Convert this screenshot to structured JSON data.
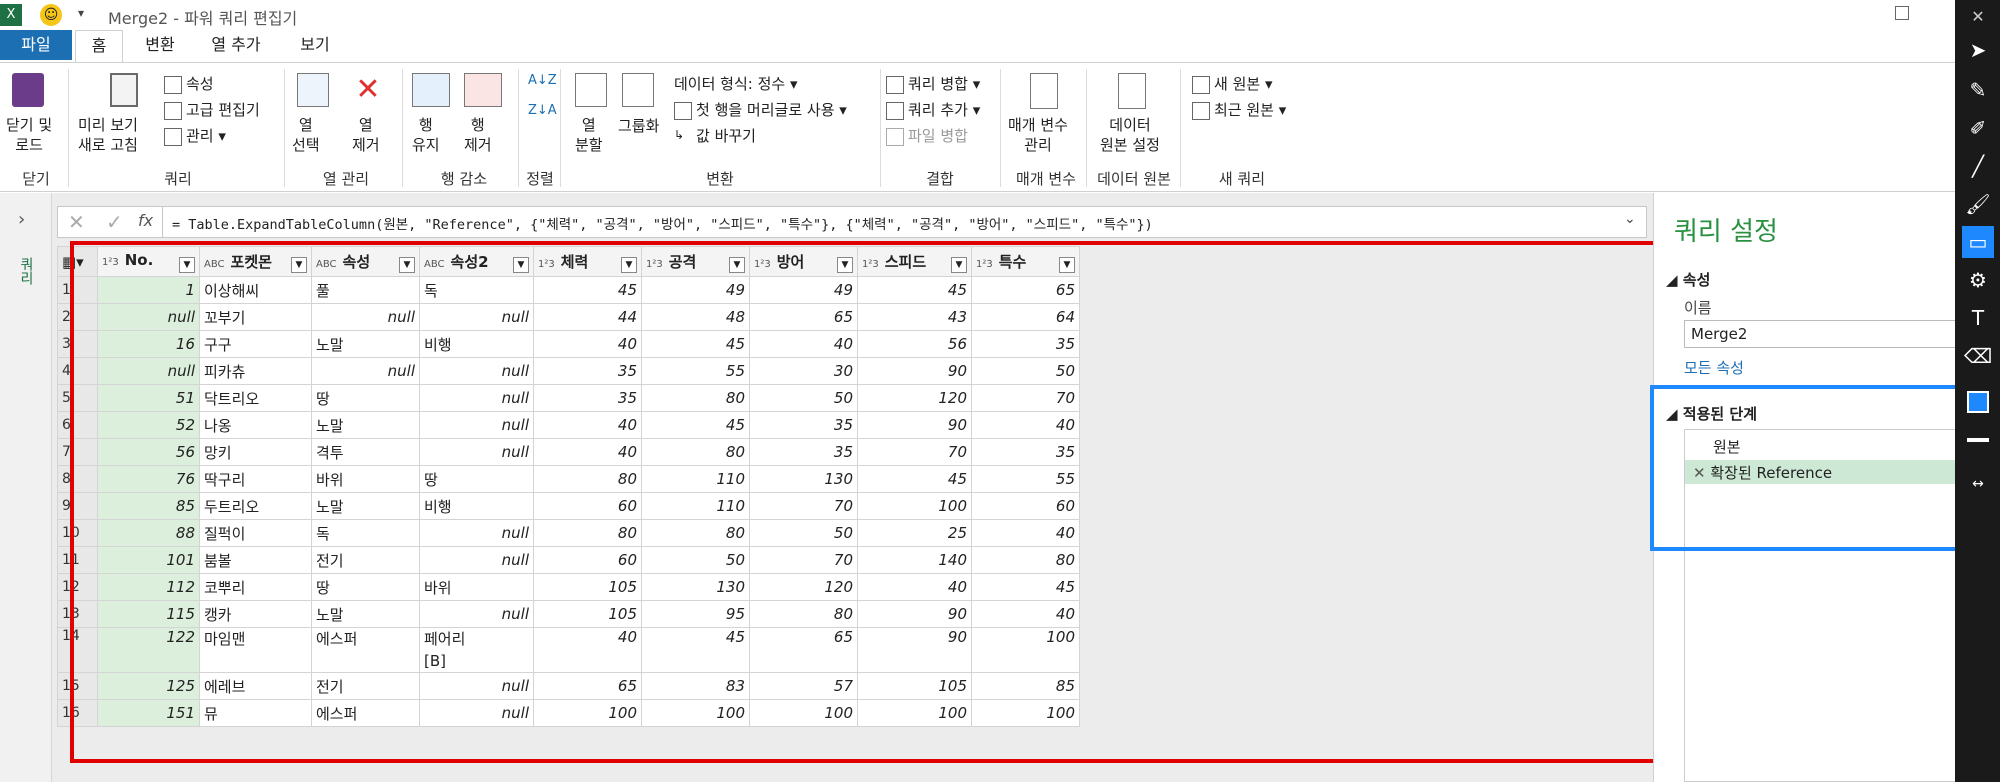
{
  "window": {
    "title": "Merge2 - 파워 쿼리 편집기"
  },
  "tabs": [
    "파일",
    "홈",
    "변환",
    "열 추가",
    "보기"
  ],
  "ribbon": {
    "close_load": "닫기 및\n로드",
    "preview_refresh": "미리 보기\n새로 고침",
    "properties": "속성",
    "advanced_editor": "고급 편집기",
    "manage": "관리",
    "choose_cols": "열\n선택",
    "remove_cols": "열\n제거",
    "keep_rows": "행\n유지",
    "remove_rows": "행\n제거",
    "split_col": "열\n분할",
    "group_by": "그룹화",
    "data_type": "데이터 형식: 정수",
    "first_row_header": "첫 행을 머리글로 사용",
    "replace_values": "값 바꾸기",
    "merge_queries": "쿼리 병합",
    "append_queries": "쿼리 추가",
    "merge_files": "파일 병합",
    "manage_params": "매개 변수\n관리",
    "data_source_settings": "데이터\n원본 설정",
    "new_source": "새 원본",
    "recent_source": "최근 원본",
    "groups": [
      "닫기",
      "쿼리",
      "열 관리",
      "행 감소",
      "정렬",
      "변환",
      "결합",
      "매개 변수",
      "데이터 원본",
      "새 쿼리"
    ]
  },
  "left_pane": {
    "label": "쿼리"
  },
  "formula": "= Table.ExpandTableColumn(원본, \"Reference\", {\"체력\", \"공격\", \"방어\", \"스피드\", \"특수\"}, {\"체력\", \"공격\", \"방어\", \"스피드\", \"특수\"})",
  "table": {
    "headers": [
      {
        "type": "1²3",
        "label": "No."
      },
      {
        "type": "ABC",
        "label": "포켓몬"
      },
      {
        "type": "ABC",
        "label": "속성"
      },
      {
        "type": "ABC",
        "label": "속성2"
      },
      {
        "type": "1²3",
        "label": "체력"
      },
      {
        "type": "1²3",
        "label": "공격"
      },
      {
        "type": "1²3",
        "label": "방어"
      },
      {
        "type": "1²3",
        "label": "스피드"
      },
      {
        "type": "1²3",
        "label": "특수"
      }
    ],
    "rows": [
      [
        "1",
        "1",
        "이상해씨",
        "풀",
        "독",
        "45",
        "49",
        "49",
        "45",
        "65"
      ],
      [
        "2",
        "null",
        "꼬부기",
        "null",
        "null",
        "44",
        "48",
        "65",
        "43",
        "64"
      ],
      [
        "3",
        "16",
        "구구",
        "노말",
        "비행",
        "40",
        "45",
        "40",
        "56",
        "35"
      ],
      [
        "4",
        "null",
        "피카츄",
        "null",
        "null",
        "35",
        "55",
        "30",
        "90",
        "50"
      ],
      [
        "5",
        "51",
        "닥트리오",
        "땅",
        "null",
        "35",
        "80",
        "50",
        "120",
        "70"
      ],
      [
        "6",
        "52",
        "나옹",
        "노말",
        "null",
        "40",
        "45",
        "35",
        "90",
        "40"
      ],
      [
        "7",
        "56",
        "망키",
        "격투",
        "null",
        "40",
        "80",
        "35",
        "70",
        "35"
      ],
      [
        "8",
        "76",
        "딱구리",
        "바위",
        "땅",
        "80",
        "110",
        "130",
        "45",
        "55"
      ],
      [
        "9",
        "85",
        "두트리오",
        "노말",
        "비행",
        "60",
        "110",
        "70",
        "100",
        "60"
      ],
      [
        "10",
        "88",
        "질퍽이",
        "독",
        "null",
        "80",
        "80",
        "50",
        "25",
        "40"
      ],
      [
        "11",
        "101",
        "붐볼",
        "전기",
        "null",
        "60",
        "50",
        "70",
        "140",
        "80"
      ],
      [
        "12",
        "112",
        "코뿌리",
        "땅",
        "바위",
        "105",
        "130",
        "120",
        "40",
        "45"
      ],
      [
        "13",
        "115",
        "캥카",
        "노말",
        "null",
        "105",
        "95",
        "80",
        "90",
        "40"
      ],
      [
        "14",
        "122",
        "마임맨",
        "에스퍼",
        "페어리\n[B]",
        "40",
        "45",
        "65",
        "90",
        "100"
      ],
      [
        "15",
        "125",
        "에레브",
        "전기",
        "null",
        "65",
        "83",
        "57",
        "105",
        "85"
      ],
      [
        "16",
        "151",
        "뮤",
        "에스퍼",
        "null",
        "100",
        "100",
        "100",
        "100",
        "100"
      ]
    ]
  },
  "settings": {
    "title": "쿼리 설정",
    "properties": "속성",
    "name_label": "이름",
    "name_value": "Merge2",
    "all_properties": "모든 속성",
    "applied_steps": "적용된 단계",
    "steps": [
      "원본",
      "확장된 Reference"
    ]
  },
  "colors": {
    "accent": "#1c6fb3",
    "highlight_red": "#e00000",
    "highlight_blue": "#1e88ff",
    "step_selected": "#cde8d4",
    "col_no": "#dcefdc"
  }
}
